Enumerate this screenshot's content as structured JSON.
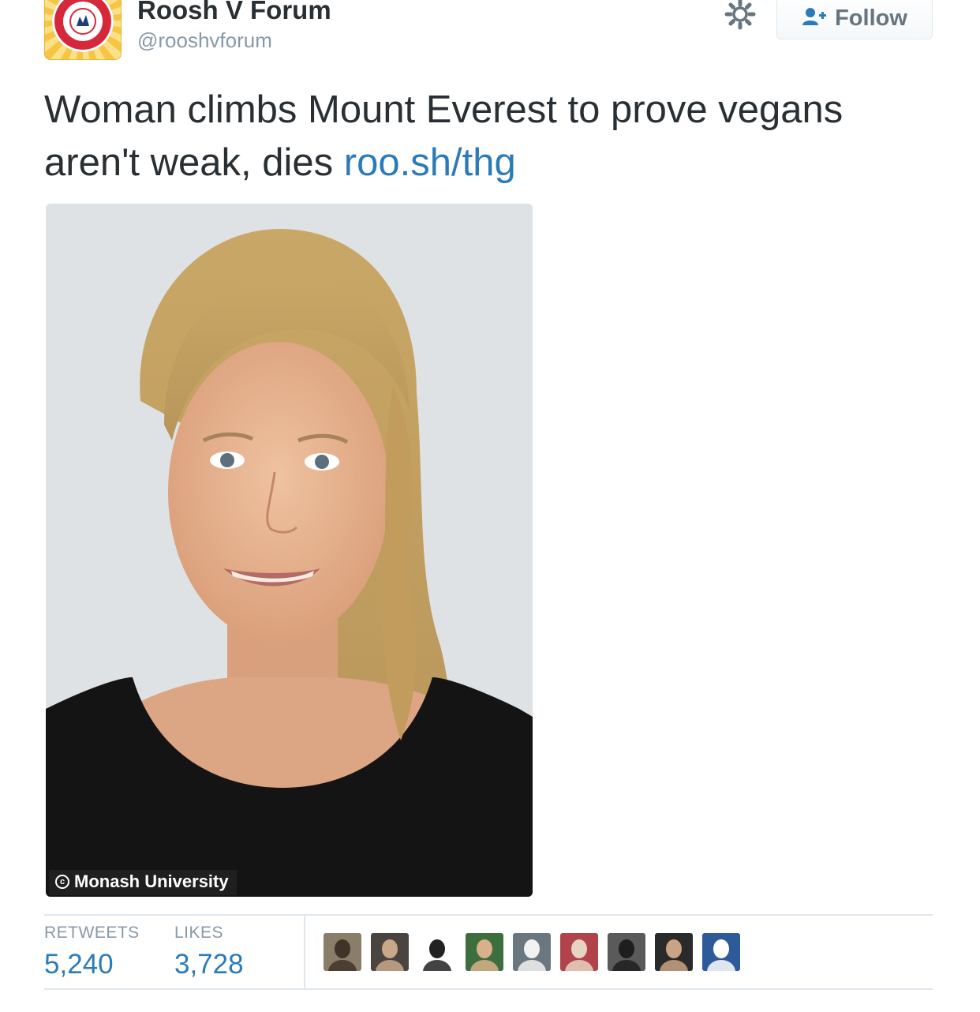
{
  "account": {
    "display_name": "Roosh V Forum",
    "handle": "@rooshvforum",
    "avatar_icon": "baking-soda-badge-icon"
  },
  "actions": {
    "settings_icon": "gear-icon",
    "follow_label": "Follow",
    "follow_icon": "add-user-icon"
  },
  "tweet": {
    "text": "Woman climbs Mount Everest to prove vegans aren't weak, dies ",
    "link_text": "roo.sh/thg"
  },
  "media": {
    "credit": "Monash University"
  },
  "stats": {
    "retweets_label": "RETWEETS",
    "retweets_value": "5,240",
    "likes_label": "LIKES",
    "likes_value": "3,728"
  },
  "likers": [
    {
      "name": "liker-avatar-1",
      "bg": "#8a7d6a",
      "fg": "#3e3428"
    },
    {
      "name": "liker-avatar-2",
      "bg": "#4a4440",
      "fg": "#c8a888"
    },
    {
      "name": "liker-avatar-3",
      "bg": "#ffffff",
      "fg": "#222222"
    },
    {
      "name": "liker-avatar-4",
      "bg": "#3d6e3e",
      "fg": "#d9b08a"
    },
    {
      "name": "liker-avatar-5",
      "bg": "#6a7680",
      "fg": "#f2f2f2"
    },
    {
      "name": "liker-avatar-6",
      "bg": "#b0444a",
      "fg": "#e8d2c2"
    },
    {
      "name": "liker-avatar-7",
      "bg": "#5a5a5a",
      "fg": "#1e1e1e"
    },
    {
      "name": "liker-avatar-8",
      "bg": "#2a2a2a",
      "fg": "#caa284"
    },
    {
      "name": "liker-avatar-9",
      "bg": "#2e5a9a",
      "fg": "#ffffff"
    }
  ],
  "colors": {
    "link": "#2b7bb9",
    "muted": "#8899a6",
    "text": "#292f33",
    "border": "#e1e8ed"
  }
}
